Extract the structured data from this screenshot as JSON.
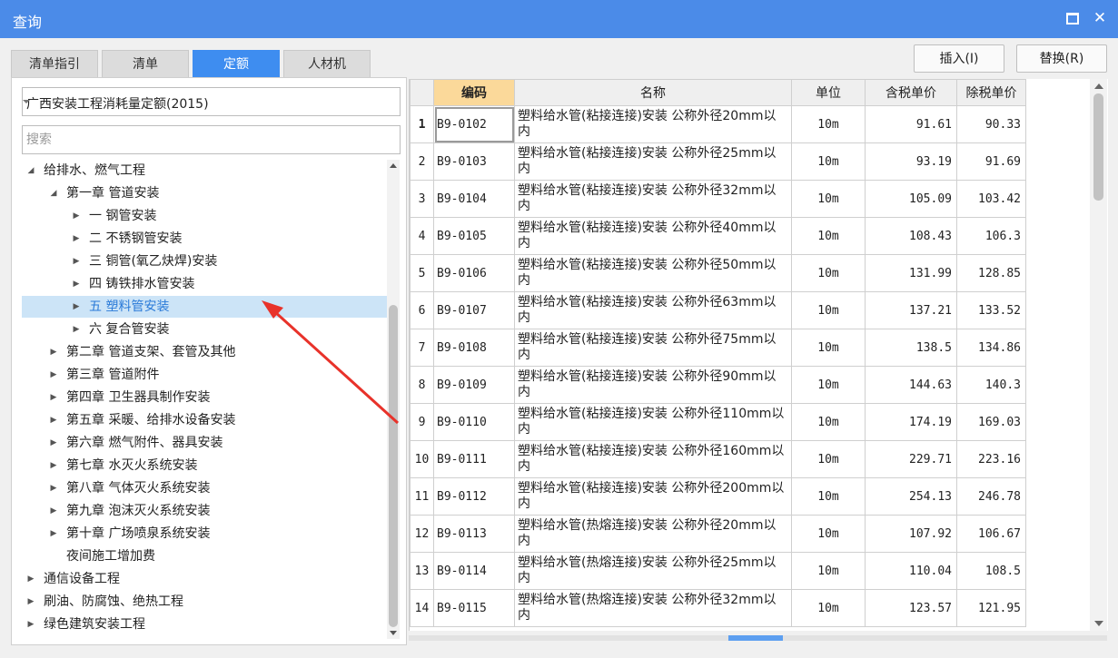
{
  "window": {
    "title": "查询"
  },
  "tabs": [
    "清单指引",
    "清单",
    "定额",
    "人材机"
  ],
  "active_tab": "定额",
  "actions": {
    "insert": "插入(I)",
    "replace": "替换(R)"
  },
  "left": {
    "library": "广西安装工程消耗量定额(2015)",
    "search_placeholder": "搜索",
    "tree": [
      {
        "label": "给排水、燃气工程",
        "level": 0,
        "state": "expanded"
      },
      {
        "label": "第一章 管道安装",
        "level": 1,
        "state": "expanded"
      },
      {
        "label": "一 钢管安装",
        "level": 2,
        "state": "collapsed"
      },
      {
        "label": "二 不锈钢管安装",
        "level": 2,
        "state": "collapsed"
      },
      {
        "label": "三 铜管(氧乙炔焊)安装",
        "level": 2,
        "state": "collapsed"
      },
      {
        "label": "四 铸铁排水管安装",
        "level": 2,
        "state": "collapsed"
      },
      {
        "label": "五 塑料管安装",
        "level": 2,
        "state": "collapsed",
        "selected": true
      },
      {
        "label": "六 复合管安装",
        "level": 2,
        "state": "collapsed"
      },
      {
        "label": "第二章 管道支架、套管及其他",
        "level": 1,
        "state": "collapsed"
      },
      {
        "label": "第三章 管道附件",
        "level": 1,
        "state": "collapsed"
      },
      {
        "label": "第四章 卫生器具制作安装",
        "level": 1,
        "state": "collapsed"
      },
      {
        "label": "第五章 采暖、给排水设备安装",
        "level": 1,
        "state": "collapsed"
      },
      {
        "label": "第六章 燃气附件、器具安装",
        "level": 1,
        "state": "collapsed"
      },
      {
        "label": "第七章 水灭火系统安装",
        "level": 1,
        "state": "collapsed"
      },
      {
        "label": "第八章 气体灭火系统安装",
        "level": 1,
        "state": "collapsed"
      },
      {
        "label": "第九章 泡沫灭火系统安装",
        "level": 1,
        "state": "collapsed"
      },
      {
        "label": "第十章 广场喷泉系统安装",
        "level": 1,
        "state": "collapsed"
      },
      {
        "label": "夜间施工增加费",
        "level": 1,
        "state": "leaf"
      },
      {
        "label": "通信设备工程",
        "level": 0,
        "state": "collapsed"
      },
      {
        "label": "刷油、防腐蚀、绝热工程",
        "level": 0,
        "state": "collapsed"
      },
      {
        "label": "绿色建筑安装工程",
        "level": 0,
        "state": "collapsed"
      }
    ]
  },
  "table": {
    "columns": [
      "编码",
      "名称",
      "单位",
      "含税单价",
      "除税单价"
    ],
    "rows": [
      {
        "no": "1",
        "code": "B9-0102",
        "name": "塑料给水管(粘接连接)安装 公称外径20mm以内",
        "unit": "10m",
        "price_tax": "91.61",
        "price_notax": "90.33"
      },
      {
        "no": "2",
        "code": "B9-0103",
        "name": "塑料给水管(粘接连接)安装 公称外径25mm以内",
        "unit": "10m",
        "price_tax": "93.19",
        "price_notax": "91.69"
      },
      {
        "no": "3",
        "code": "B9-0104",
        "name": "塑料给水管(粘接连接)安装 公称外径32mm以内",
        "unit": "10m",
        "price_tax": "105.09",
        "price_notax": "103.42"
      },
      {
        "no": "4",
        "code": "B9-0105",
        "name": "塑料给水管(粘接连接)安装 公称外径40mm以内",
        "unit": "10m",
        "price_tax": "108.43",
        "price_notax": "106.3"
      },
      {
        "no": "5",
        "code": "B9-0106",
        "name": "塑料给水管(粘接连接)安装 公称外径50mm以内",
        "unit": "10m",
        "price_tax": "131.99",
        "price_notax": "128.85"
      },
      {
        "no": "6",
        "code": "B9-0107",
        "name": "塑料给水管(粘接连接)安装 公称外径63mm以内",
        "unit": "10m",
        "price_tax": "137.21",
        "price_notax": "133.52"
      },
      {
        "no": "7",
        "code": "B9-0108",
        "name": "塑料给水管(粘接连接)安装 公称外径75mm以内",
        "unit": "10m",
        "price_tax": "138.5",
        "price_notax": "134.86"
      },
      {
        "no": "8",
        "code": "B9-0109",
        "name": "塑料给水管(粘接连接)安装 公称外径90mm以内",
        "unit": "10m",
        "price_tax": "144.63",
        "price_notax": "140.3"
      },
      {
        "no": "9",
        "code": "B9-0110",
        "name": "塑料给水管(粘接连接)安装 公称外径110mm以内",
        "unit": "10m",
        "price_tax": "174.19",
        "price_notax": "169.03"
      },
      {
        "no": "10",
        "code": "B9-0111",
        "name": "塑料给水管(粘接连接)安装 公称外径160mm以内",
        "unit": "10m",
        "price_tax": "229.71",
        "price_notax": "223.16"
      },
      {
        "no": "11",
        "code": "B9-0112",
        "name": "塑料给水管(粘接连接)安装 公称外径200mm以内",
        "unit": "10m",
        "price_tax": "254.13",
        "price_notax": "246.78"
      },
      {
        "no": "12",
        "code": "B9-0113",
        "name": "塑料给水管(热熔连接)安装 公称外径20mm以内",
        "unit": "10m",
        "price_tax": "107.92",
        "price_notax": "106.67"
      },
      {
        "no": "13",
        "code": "B9-0114",
        "name": "塑料给水管(热熔连接)安装 公称外径25mm以内",
        "unit": "10m",
        "price_tax": "110.04",
        "price_notax": "108.5"
      },
      {
        "no": "14",
        "code": "B9-0115",
        "name": "塑料给水管(热熔连接)安装 公称外径32mm以内",
        "unit": "10m",
        "price_tax": "123.57",
        "price_notax": "121.95"
      }
    ]
  },
  "colors": {
    "titlebar": "#4b8be8",
    "tab_active": "#3e8df0",
    "header_highlight": "#fbd99a",
    "tree_selected": "#cce4f7",
    "annotation_arrow": "#e8322a"
  }
}
